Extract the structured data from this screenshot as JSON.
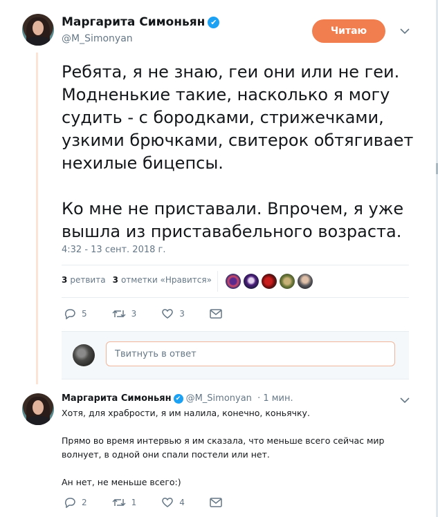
{
  "tweet": {
    "author_name": "Маргарита Симоньян",
    "author_handle": "@M_Simonyan",
    "follow_label": "Читаю",
    "text_paragraphs": [
      "Ребята, я не знаю, геи они или не геи. Модненькие такие, насколько я могу судить - с бородками, стрижечками, узкими брючками, свитерок обтягивает нехилые бицепсы.",
      "Ко мне не приставали. Впрочем, я уже вышла из приставабельного возраста."
    ],
    "timestamp": "4:32 - 13 сент. 2018 г.",
    "retweets_count": "3",
    "retweets_label": "ретвита",
    "likes_count": "3",
    "likes_label": "отметки «Нравится»",
    "actions": {
      "replies": "5",
      "retweets": "3",
      "likes": "3"
    }
  },
  "reply_composer": {
    "placeholder": "Твитнуть в ответ"
  },
  "reply": {
    "author_name": "Маргарита Симоньян",
    "author_handle": "@M_Simonyan",
    "time": "· 1 мин.",
    "text_paragraphs": [
      "Хотя, для храбрости, я им налила, конечно, коньячку.",
      "Прямо во время интервью я им сказала, что меньше всего сейчас мир волнует, в одной они спали постели или нет.",
      "Ан нет, не меньше всего:)"
    ],
    "actions": {
      "replies": "2",
      "retweets": "1",
      "likes": "4"
    }
  },
  "colors": {
    "accent": "#f07e4f",
    "verified": "#1da1f2",
    "muted": "#657786"
  }
}
